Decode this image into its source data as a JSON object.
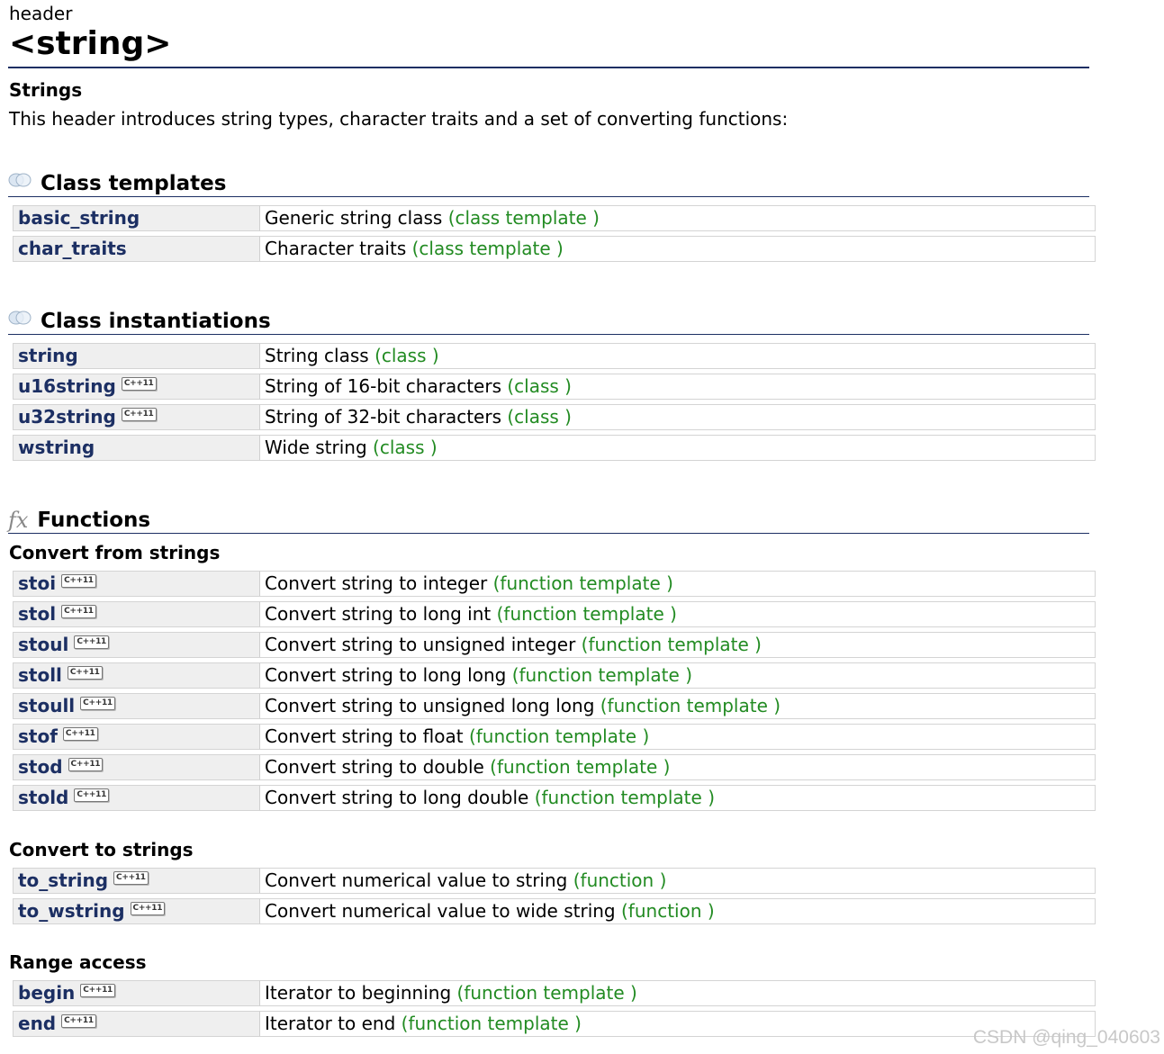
{
  "header": {
    "kicker": "header",
    "title": "<string>"
  },
  "intro": {
    "heading": "Strings",
    "text": "This header introduces string types, character traits and a set of converting functions:"
  },
  "sections": {
    "class_templates": {
      "heading": "Class templates",
      "icon": "class-icon",
      "rows": [
        {
          "name": "basic_string",
          "badge": "",
          "desc": "Generic string class ",
          "kind": "(class template )"
        },
        {
          "name": "char_traits",
          "badge": "",
          "desc": "Character traits ",
          "kind": "(class template )"
        }
      ]
    },
    "class_instantiations": {
      "heading": "Class instantiations",
      "icon": "class-icon",
      "rows": [
        {
          "name": "string",
          "badge": "",
          "desc": "String class ",
          "kind": "(class )"
        },
        {
          "name": "u16string",
          "badge": "C++11",
          "desc": "String of 16-bit characters ",
          "kind": "(class )"
        },
        {
          "name": "u32string",
          "badge": "C++11",
          "desc": "String of 32-bit characters ",
          "kind": "(class )"
        },
        {
          "name": "wstring",
          "badge": "",
          "desc": "Wide string ",
          "kind": "(class )"
        }
      ]
    },
    "functions": {
      "heading": "Functions",
      "icon": "fx-icon",
      "convert_from": {
        "heading": "Convert from strings",
        "rows": [
          {
            "name": "stoi",
            "badge": "C++11",
            "desc": "Convert string to integer ",
            "kind": "(function template )"
          },
          {
            "name": "stol",
            "badge": "C++11",
            "desc": "Convert string to long int ",
            "kind": "(function template )"
          },
          {
            "name": "stoul",
            "badge": "C++11",
            "desc": "Convert string to unsigned integer ",
            "kind": "(function template )"
          },
          {
            "name": "stoll",
            "badge": "C++11",
            "desc": "Convert string to long long ",
            "kind": "(function template )"
          },
          {
            "name": "stoull",
            "badge": "C++11",
            "desc": "Convert string to unsigned long long ",
            "kind": "(function template )"
          },
          {
            "name": "stof",
            "badge": "C++11",
            "desc": "Convert string to float ",
            "kind": "(function template )"
          },
          {
            "name": "stod",
            "badge": "C++11",
            "desc": "Convert string to double ",
            "kind": "(function template )"
          },
          {
            "name": "stold",
            "badge": "C++11",
            "desc": "Convert string to long double ",
            "kind": "(function template )"
          }
        ]
      },
      "convert_to": {
        "heading": "Convert to strings",
        "rows": [
          {
            "name": "to_string",
            "badge": "C++11",
            "desc": "Convert numerical value to string ",
            "kind": "(function )"
          },
          {
            "name": "to_wstring",
            "badge": "C++11",
            "desc": "Convert numerical value to wide string ",
            "kind": "(function )"
          }
        ]
      },
      "range_access": {
        "heading": "Range access",
        "rows": [
          {
            "name": "begin",
            "badge": "C++11",
            "desc": "Iterator to beginning ",
            "kind": "(function template )"
          },
          {
            "name": "end",
            "badge": "C++11",
            "desc": "Iterator to end ",
            "kind": "(function template )"
          }
        ]
      }
    }
  },
  "colors": {
    "link": "#1c2f63",
    "kind": "#228b22",
    "name_cell_bg": "#efefef",
    "rule": "#1c2f63"
  },
  "watermark": "CSDN @qing_040603"
}
